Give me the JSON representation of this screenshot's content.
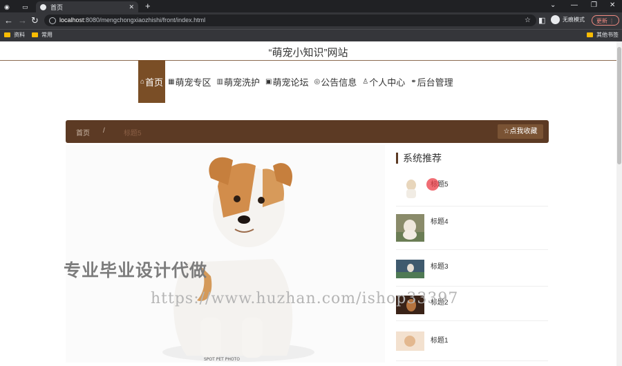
{
  "browser": {
    "tab_title": "首页",
    "url_host": "localhost",
    "url_rest": ":8080/mengchongxiaozhishi/front/index.html",
    "profile_label": "无痕模式",
    "update_label": "更新",
    "bookmarks": [
      "资料",
      "常用"
    ],
    "bookmarks_right": "其他书签"
  },
  "site": {
    "title": "“萌宠小知识”网站"
  },
  "nav": [
    {
      "icon": "home-icon",
      "glyph": "⌂",
      "label": "首页"
    },
    {
      "icon": "grid-icon",
      "glyph": "▦",
      "label": "萌宠专区"
    },
    {
      "icon": "grid-icon",
      "glyph": "▥",
      "label": "萌宠洗护"
    },
    {
      "icon": "grid-icon",
      "glyph": "▣",
      "label": "萌宠论坛"
    },
    {
      "icon": "bell-icon",
      "glyph": "◎",
      "label": "公告信息"
    },
    {
      "icon": "user-icon",
      "glyph": "♙",
      "label": "个人中心"
    },
    {
      "icon": "link-icon",
      "glyph": "⚭",
      "label": "后台管理"
    }
  ],
  "breadcrumb": {
    "home": "首页",
    "sep": "/",
    "current": "标题5",
    "fav_label": "☆点我收藏"
  },
  "recommend": {
    "title": "系统推荐",
    "items": [
      {
        "name": "标题5"
      },
      {
        "name": "标题4"
      },
      {
        "name": "标题3"
      },
      {
        "name": "标题2"
      },
      {
        "name": "标题1"
      }
    ]
  },
  "overlay": {
    "cn_text": "专业毕业设计代做",
    "url_text": "https://www.huzhan.com/ishop33397"
  },
  "colors": {
    "accent": "#7a4e26",
    "breadcrumb_bg": "#5c3a24"
  }
}
